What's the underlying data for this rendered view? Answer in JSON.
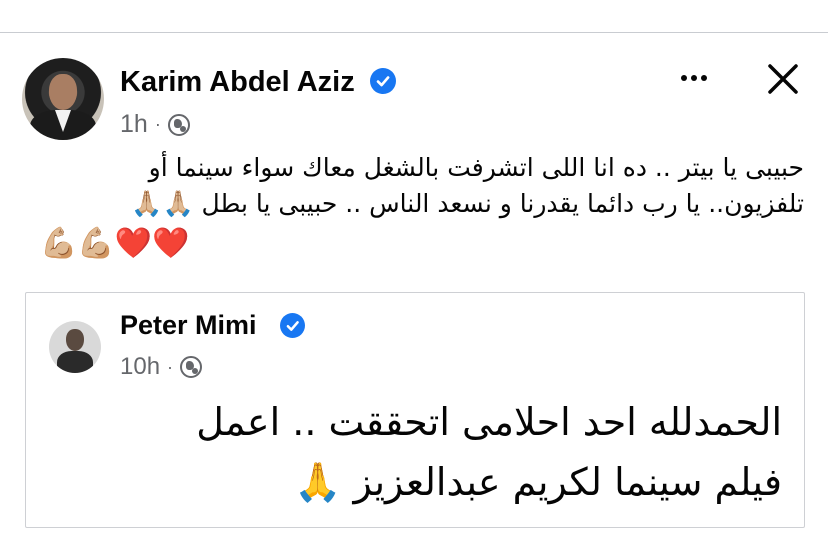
{
  "post": {
    "author": "Karim Abdel Aziz",
    "time": "1h",
    "separator": "·",
    "text_lines": [
      "حبيبى يا بيتر .. ده انا اللى اتشرفت بالشغل معاك سواء سينما أو",
      "تلفزيون.. يا رب دائما يقدرنا و نسعد الناس .. حبيبى يا بطل 🙏🏼🙏🏼",
      "❤️❤️💪🏼💪🏼"
    ],
    "icons": {
      "more": "more-horizontal-icon",
      "close": "close-icon",
      "audience": "globe-icon",
      "verified": "verified-badge-icon"
    }
  },
  "shared": {
    "author": "Peter Mimi",
    "time": "10h",
    "separator": "·",
    "text_lines": [
      "الحمدلله احد احلامى اتحققت .. اعمل",
      "فيلم سينما لكريم عبدالعزيز 🙏"
    ]
  },
  "colors": {
    "verified": "#1877f2",
    "meta_text": "#65676b",
    "text": "#050505",
    "card_border": "#ced0d4"
  }
}
